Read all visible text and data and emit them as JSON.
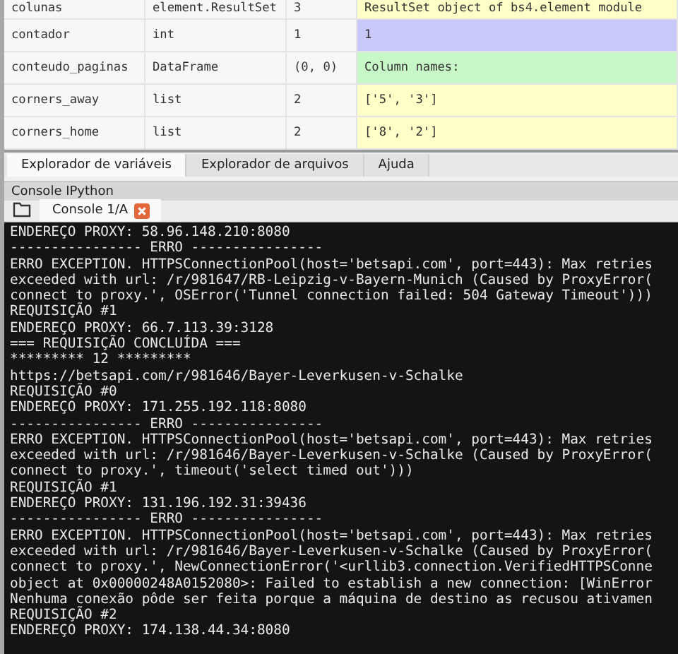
{
  "variables": [
    {
      "name": "colunas",
      "type": "element.ResultSet",
      "size": "3",
      "value": "ResultSet object of bs4.element module",
      "color": "#ffffc8"
    },
    {
      "name": "contador",
      "type": "int",
      "size": "1",
      "value": "1",
      "color": "#c8c8fa"
    },
    {
      "name": "conteudo_paginas",
      "type": "DataFrame",
      "size": "(0, 0)",
      "value": "Column names:",
      "color": "#c8f8c8"
    },
    {
      "name": "corners_away",
      "type": "list",
      "size": "2",
      "value": "['5', '3']",
      "color": "#ffffc8"
    },
    {
      "name": "corners_home",
      "type": "list",
      "size": "2",
      "value": "['8', '2']",
      "color": "#ffffc8"
    }
  ],
  "tabs": [
    {
      "label": "Explorador de variáveis",
      "selected": true
    },
    {
      "label": "Explorador de arquivos",
      "selected": false
    },
    {
      "label": "Ajuda",
      "selected": false
    }
  ],
  "console_pane": {
    "title": "Console IPython",
    "tab": "Console 1/A"
  },
  "console_lines": [
    "ENDEREÇO PROXY: 58.96.148.210:8080",
    "---------------- ERRO ----------------",
    "ERRO EXCEPTION. HTTPSConnectionPool(host='betsapi.com', port=443): Max retries",
    "exceeded with url: /r/981647/RB-Leipzig-v-Bayern-Munich (Caused by ProxyError(",
    "connect to proxy.', OSError('Tunnel connection failed: 504 Gateway Timeout')))",
    "REQUISIÇÃO #1",
    "ENDEREÇO PROXY: 66.7.113.39:3128",
    "=== REQUISIÇÃO CONCLUÍDA ===",
    "********* 12 *********",
    "https://betsapi.com/r/981646/Bayer-Leverkusen-v-Schalke",
    "REQUISIÇÃO #0",
    "ENDEREÇO PROXY: 171.255.192.118:8080",
    "---------------- ERRO ----------------",
    "ERRO EXCEPTION. HTTPSConnectionPool(host='betsapi.com', port=443): Max retries",
    "exceeded with url: /r/981646/Bayer-Leverkusen-v-Schalke (Caused by ProxyError(",
    "connect to proxy.', timeout('select timed out')))",
    "REQUISIÇÃO #1",
    "ENDEREÇO PROXY: 131.196.192.31:39436",
    "---------------- ERRO ----------------",
    "ERRO EXCEPTION. HTTPSConnectionPool(host='betsapi.com', port=443): Max retries",
    "exceeded with url: /r/981646/Bayer-Leverkusen-v-Schalke (Caused by ProxyError(",
    "connect to proxy.', NewConnectionError('<urllib3.connection.VerifiedHTTPSConne",
    "object at 0x00000248A0152080>: Failed to establish a new connection: [WinError",
    "Nenhuma conexão pôde ser feita porque a máquina de destino as recusou ativamen",
    "REQUISIÇÃO #2",
    "ENDEREÇO PROXY: 174.138.44.34:8080"
  ]
}
